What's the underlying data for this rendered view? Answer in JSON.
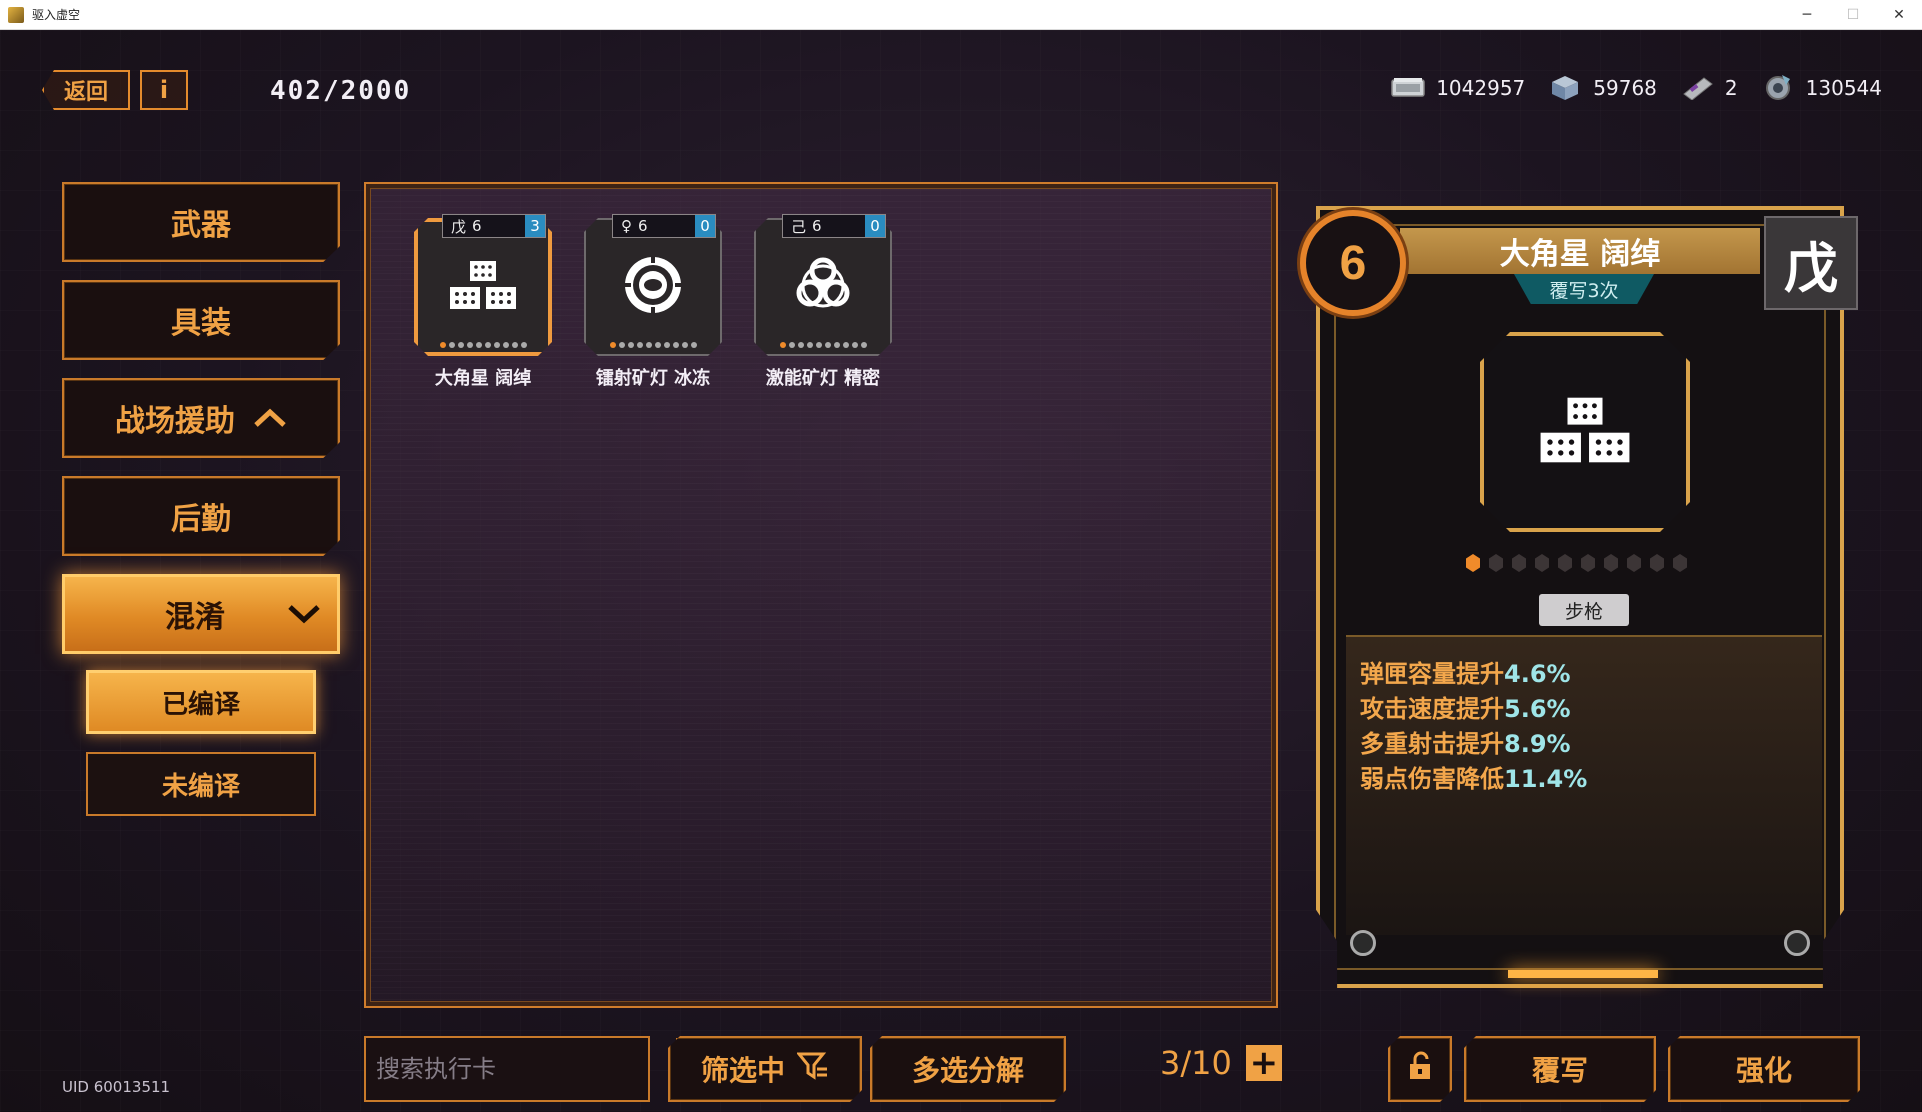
{
  "window": {
    "title": "驱入虚空"
  },
  "top": {
    "back_label": "返回",
    "info_label": "i",
    "capacity": "402/2000",
    "currencies": [
      {
        "icon": "cash-icon",
        "value": "1042957"
      },
      {
        "icon": "cube-icon",
        "value": "59768"
      },
      {
        "icon": "ticket-icon",
        "value": "2"
      },
      {
        "icon": "gear-crystal-icon",
        "value": "130544"
      }
    ]
  },
  "nav": {
    "items": [
      {
        "label": "武器"
      },
      {
        "label": "具装"
      },
      {
        "label": "战场援助"
      },
      {
        "label": "后勤"
      },
      {
        "label": "混淆"
      }
    ],
    "sub_items": [
      {
        "label": "已编译"
      },
      {
        "label": "未编译"
      }
    ]
  },
  "uid": "UID 60013511",
  "cards": [
    {
      "name": "大角星 阔绰",
      "symbol": "戊",
      "level": "6",
      "count": "3",
      "icon": "blocks-icon",
      "selected": true
    },
    {
      "name": "镭射矿灯 冰冻",
      "symbol": "♀",
      "level": "6",
      "count": "0",
      "icon": "ring-icon",
      "selected": false
    },
    {
      "name": "激能矿灯 精密",
      "symbol": "己",
      "level": "6",
      "count": "0",
      "icon": "biohazard-icon",
      "selected": false
    }
  ],
  "bottom": {
    "search_placeholder": "搜索执行卡",
    "filter_label": "筛选中",
    "multi_label": "多选分解",
    "page": "3/10",
    "overwrite_label": "覆写",
    "enhance_label": "强化"
  },
  "detail": {
    "level": "6",
    "symbol": "戊",
    "title": "大角星 阔绰",
    "overwrite_times": "覆写3次",
    "weapon_type": "步枪",
    "level_dots_total": 10,
    "level_dots_on": 1,
    "stats": [
      {
        "label": "弹匣容量提升",
        "value": "4.6%"
      },
      {
        "label": "攻击速度提升",
        "value": "5.6%"
      },
      {
        "label": "多重射击提升",
        "value": "8.9%"
      },
      {
        "label": "弱点伤害降低",
        "value": "11.4%"
      }
    ]
  },
  "colors": {
    "accent": "#f0a245",
    "accent_dark": "#c97a2a",
    "gold": "#d9a34b",
    "stat_value": "#9fe5e8",
    "count_badge": "#2a8cc0"
  }
}
